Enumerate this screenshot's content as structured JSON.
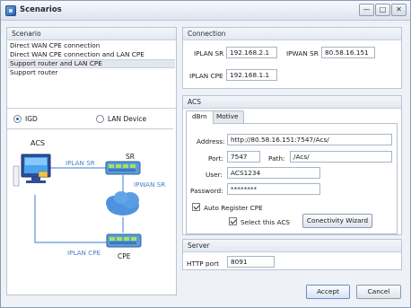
{
  "window": {
    "title": "Scenarios",
    "controls": [
      "—",
      "□",
      "✕"
    ]
  },
  "scenario": {
    "header": "Scenario",
    "items": [
      "Direct WAN CPE connection",
      "Direct WAN CPE connection and LAN CPE",
      "Support router and LAN CPE",
      "Support router"
    ],
    "selected_index": 2,
    "radio_igd": "IGD",
    "radio_lan": "LAN Device",
    "selected_radio": "IGD"
  },
  "diagram": {
    "acs_label": "ACS",
    "sr_label": "SR",
    "cpe_label": "CPE",
    "iplan_sr_label": "IPLAN SR",
    "ipwan_sr_label": "IPWAN SR",
    "iplan_cpe_label": "IPLAN CPE",
    "accent_color": "#3a7bd5",
    "label_color": "#4a7fc8"
  },
  "connection": {
    "header": "Connection",
    "iplan_sr_label": "IPLAN SR",
    "iplan_sr_value": "192.168.2.1",
    "ipwan_sr_label": "IPWAN SR",
    "ipwan_sr_value": "80.58.16.151",
    "iplan_cpe_label": "IPLAN CPE",
    "iplan_cpe_value": "192.168.1.1"
  },
  "acs": {
    "header": "ACS",
    "tabs": [
      "dBm",
      "Motive"
    ],
    "active_tab": "dBm",
    "address_label": "Address:",
    "address_value": "http://80.58.16.151:7547/Acs/",
    "port_label": "Port:",
    "port_value": "7547",
    "path_label": "Path:",
    "path_value": "/Acs/",
    "user_label": "User:",
    "user_value": "ACS1234",
    "password_label": "Password:",
    "password_value": "********",
    "auto_register_label": "Auto Register CPE",
    "auto_register_checked": true,
    "select_acs_label": "Select this ACS",
    "select_acs_checked": true,
    "wizard_button": "Conectivity Wizard"
  },
  "server": {
    "header": "Server",
    "http_port_label": "HTTP port",
    "http_port_value": "8091"
  },
  "footer": {
    "accept": "Accept",
    "cancel": "Cancel"
  }
}
